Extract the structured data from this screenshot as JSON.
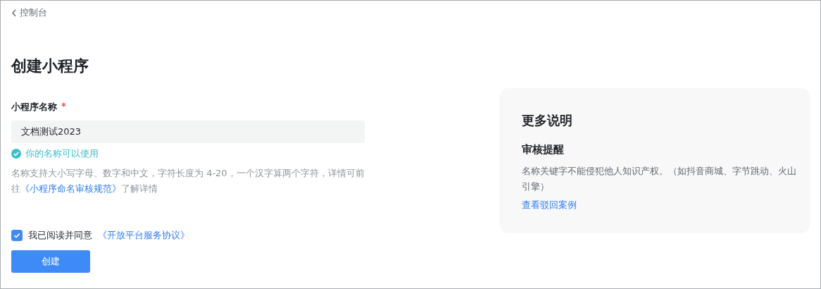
{
  "back_link": {
    "label": "控制台"
  },
  "page_title": "创建小程序",
  "name_field": {
    "label": "小程序名称",
    "required": true,
    "value": "文档测试2023",
    "validation": {
      "kind": "success",
      "text": "你的名称可以使用"
    },
    "hint": {
      "before": "名称支持大小写字母、数字和中文，字符长度为 4-20，一个汉字算两个字符，详情可前往",
      "link": "《小程序命名审核规范》",
      "after": "了解详情"
    }
  },
  "agreement": {
    "checked": true,
    "label": "我已阅读并同意",
    "link": "《开放平台服务协议》"
  },
  "submit_button": "创建",
  "info_card": {
    "title": "更多说明",
    "section_title": "审核提醒",
    "text": "名称关键字不能侵犯他人知识产权。（如抖音商城、字节跳动、火山引擎）",
    "link": "查看驳回案例"
  }
}
